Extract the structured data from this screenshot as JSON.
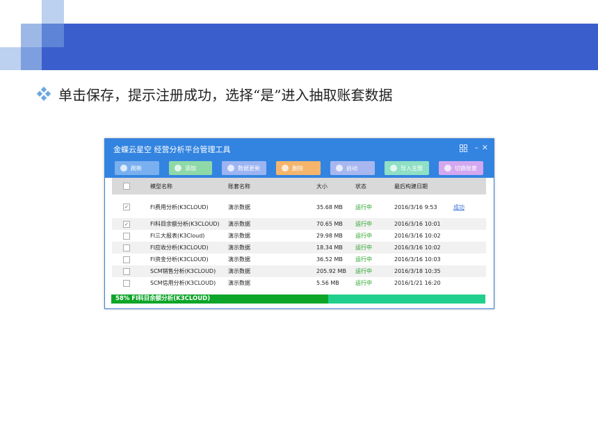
{
  "slide": {
    "bullet_text": "单击保存，提示注册成功，选择“是”进入抽取账套数据"
  },
  "window": {
    "title": "金蝶云星空 经营分析平台管理工具"
  },
  "toolbar": {
    "buttons": [
      {
        "label": "刷新",
        "color": "#7ab0ef",
        "icon": "arrow-left-icon"
      },
      {
        "label": "添加",
        "color": "#8fd9a8",
        "icon": "check-icon"
      },
      {
        "label": "数据更新",
        "color": "#9cb4f2",
        "icon": "refresh-icon"
      },
      {
        "label": "删除",
        "color": "#f5b56c",
        "icon": "delete-icon"
      },
      {
        "label": "启动",
        "color": "#a8b7f0",
        "icon": "power-icon"
      },
      {
        "label": "导入主题",
        "color": "#8fe0c4",
        "icon": "import-icon"
      },
      {
        "label": "切换账套",
        "color": "#d3a8f0",
        "icon": "switch-icon"
      }
    ]
  },
  "table": {
    "headers": {
      "name": "模型名称",
      "acct": "账套名称",
      "size": "大小",
      "status": "状态",
      "date": "最后构建日期"
    },
    "rows": [
      {
        "checked": "✓",
        "name": "FI费用分析(K3CLOUD)",
        "acct": "演示数据",
        "size": "35.68 MB",
        "status": "运行中",
        "date": "2016/3/16 9:53",
        "result": "成功"
      },
      {
        "checked": "✓",
        "name": "FI科目余额分析(K3CLOUD)",
        "acct": "演示数据",
        "size": "70.65 MB",
        "status": "运行中",
        "date": "2016/3/16 10:01",
        "result": ""
      },
      {
        "checked": "",
        "name": "FI三大报表(K3Cloud)",
        "acct": "演示数据",
        "size": "29.98 MB",
        "status": "运行中",
        "date": "2016/3/16 10:02",
        "result": ""
      },
      {
        "checked": "",
        "name": "FI应收分析(K3CLOUD)",
        "acct": "演示数据",
        "size": "18.34 MB",
        "status": "运行中",
        "date": "2016/3/16 10:02",
        "result": ""
      },
      {
        "checked": "",
        "name": "FI资金分析(K3CLOUD)",
        "acct": "演示数据",
        "size": "36.52 MB",
        "status": "运行中",
        "date": "2016/3/16 10:03",
        "result": ""
      },
      {
        "checked": "",
        "name": "SCM销售分析(K3CLOUD)",
        "acct": "演示数据",
        "size": "205.92 MB",
        "status": "运行中",
        "date": "2016/3/18 10:35",
        "result": ""
      },
      {
        "checked": "",
        "name": "SCM信用分析(K3CLOUD)",
        "acct": "演示数据",
        "size": "5.56 MB",
        "status": "运行中",
        "date": "2016/1/21 16:20",
        "result": ""
      }
    ]
  },
  "progress": {
    "text": "58%  FI科目余额分析(K3CLOUD)",
    "fraction": 0.58
  },
  "colors": {
    "banner": "#3a5fcd",
    "titlebar": "#3384e0",
    "progress_fill": "#0da629",
    "progress_track": "#21cf8c",
    "status_running": "#20a020"
  }
}
